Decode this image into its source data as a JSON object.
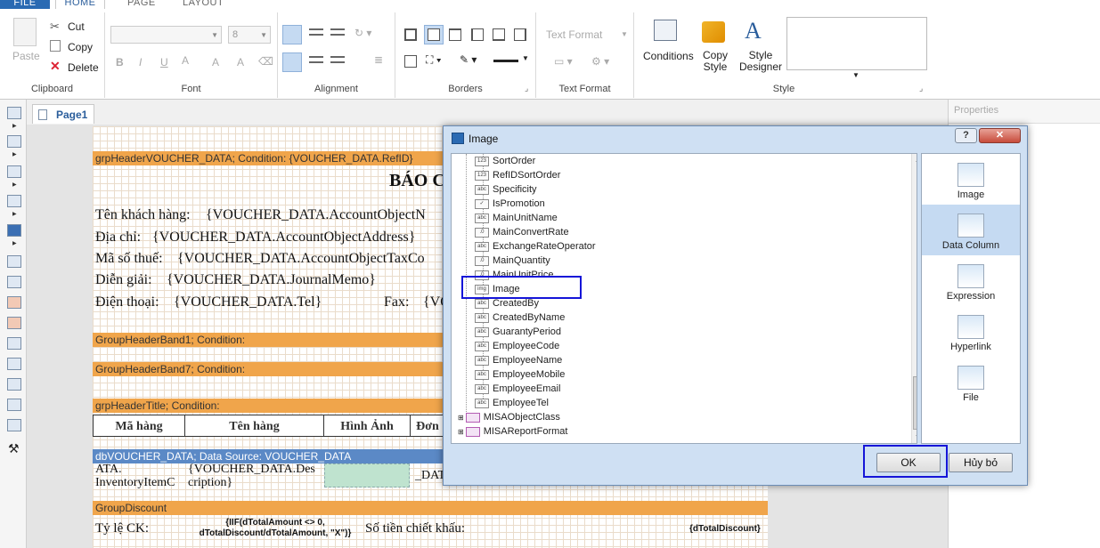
{
  "ribbon": {
    "tabs": [
      "FILE",
      "HOME",
      "PAGE",
      "LAYOUT"
    ],
    "clipboard": {
      "paste": "Paste",
      "cut": "Cut",
      "copy": "Copy",
      "delete": "Delete",
      "label": "Clipboard"
    },
    "font": {
      "size": "8",
      "label": "Font"
    },
    "alignment": {
      "label": "Alignment"
    },
    "borders": {
      "label": "Borders"
    },
    "text_format": {
      "combo": "Text Format",
      "label": "Text Format"
    },
    "style": {
      "conditions": "Conditions",
      "copy_style": [
        "Copy",
        "Style"
      ],
      "style_designer": [
        "Style",
        "Designer"
      ],
      "label": "Style"
    }
  },
  "designer": {
    "page_tab": "Page1",
    "bands": {
      "grp_header": "grpHeaderVOUCHER_DATA;  Condition:  {VOUCHER_DATA.RefID}",
      "group_header1": "GroupHeaderBand1; Condition:",
      "group_header7": "GroupHeaderBand7; Condition:",
      "grp_title": "grpHeaderTitle; Condition:",
      "db_voucher": "dbVOUCHER_DATA;  Data  Source:  VOUCHER_DATA",
      "group_discount": "GroupDiscount"
    },
    "title": "BÁO C",
    "fields": [
      {
        "label": "Tên khách hàng:",
        "value": "{VOUCHER_DATA.AccountObjectN"
      },
      {
        "label": "Địa chỉ:",
        "value": "{VOUCHER_DATA.AccountObjectAddress}"
      },
      {
        "label": "Mã số thuế:",
        "value": "{VOUCHER_DATA.AccountObjectTaxCo"
      },
      {
        "label": "Diễn giải:",
        "value": "{VOUCHER_DATA.JournalMemo}"
      },
      {
        "label": "Điện thoại:",
        "value": "{VOUCHER_DATA.Tel}"
      }
    ],
    "fax_label": "Fax:",
    "fax_value": "{VO",
    "table_headers": [
      "Mã hàng",
      "Tên hàng",
      "Hình Ảnh",
      "Đơn"
    ],
    "detail_row": {
      "col1": [
        "ATA.",
        "InventoryItemC"
      ],
      "col2": [
        "{VOUCHER_DATA.Des",
        "cription}"
      ],
      "col4": "_DAT"
    },
    "discount_row": {
      "label": "Tỷ lệ CK:",
      "expr": [
        "{IIF(dTotalAmount <> 0,",
        "dTotalDiscount/dTotalAmount, \"X\")}"
      ],
      "amount_label": "Số tiền chiết khấu:",
      "amount_value": "{dTotalDiscount}"
    }
  },
  "properties": {
    "title": "Properties"
  },
  "dialog": {
    "title": "Image",
    "help": "?",
    "close": "✕",
    "tree_items": [
      {
        "icon": "123",
        "label": "SortOrder"
      },
      {
        "icon": "123",
        "label": "RefIDSortOrder"
      },
      {
        "icon": "abc",
        "label": "Specificity"
      },
      {
        "icon": "✓",
        "label": "IsPromotion"
      },
      {
        "icon": "abc",
        "label": "MainUnitName"
      },
      {
        "icon": ".0",
        "label": "MainConvertRate"
      },
      {
        "icon": "abc",
        "label": "ExchangeRateOperator"
      },
      {
        "icon": ".0",
        "label": "MainQuantity"
      },
      {
        "icon": ".0",
        "label": "MainUnitPrice"
      },
      {
        "icon": "img",
        "label": "Image"
      },
      {
        "icon": "abc",
        "label": "CreatedBy"
      },
      {
        "icon": "abc",
        "label": "CreatedByName"
      },
      {
        "icon": "abc",
        "label": "GuarantyPeriod"
      },
      {
        "icon": "abc",
        "label": "EmployeeCode"
      },
      {
        "icon": "abc",
        "label": "EmployeeName"
      },
      {
        "icon": "abc",
        "label": "EmployeeMobile"
      },
      {
        "icon": "abc",
        "label": "EmployeeEmail"
      },
      {
        "icon": "abc",
        "label": "EmployeeTel"
      }
    ],
    "tree_groups": [
      "MISAObjectClass",
      "MISAReportFormat"
    ],
    "kinds": [
      "Image",
      "Data Column",
      "Expression",
      "Hyperlink",
      "File"
    ],
    "selected_kind": "Data Column",
    "ok": "OK",
    "cancel": "Hủy bỏ"
  }
}
